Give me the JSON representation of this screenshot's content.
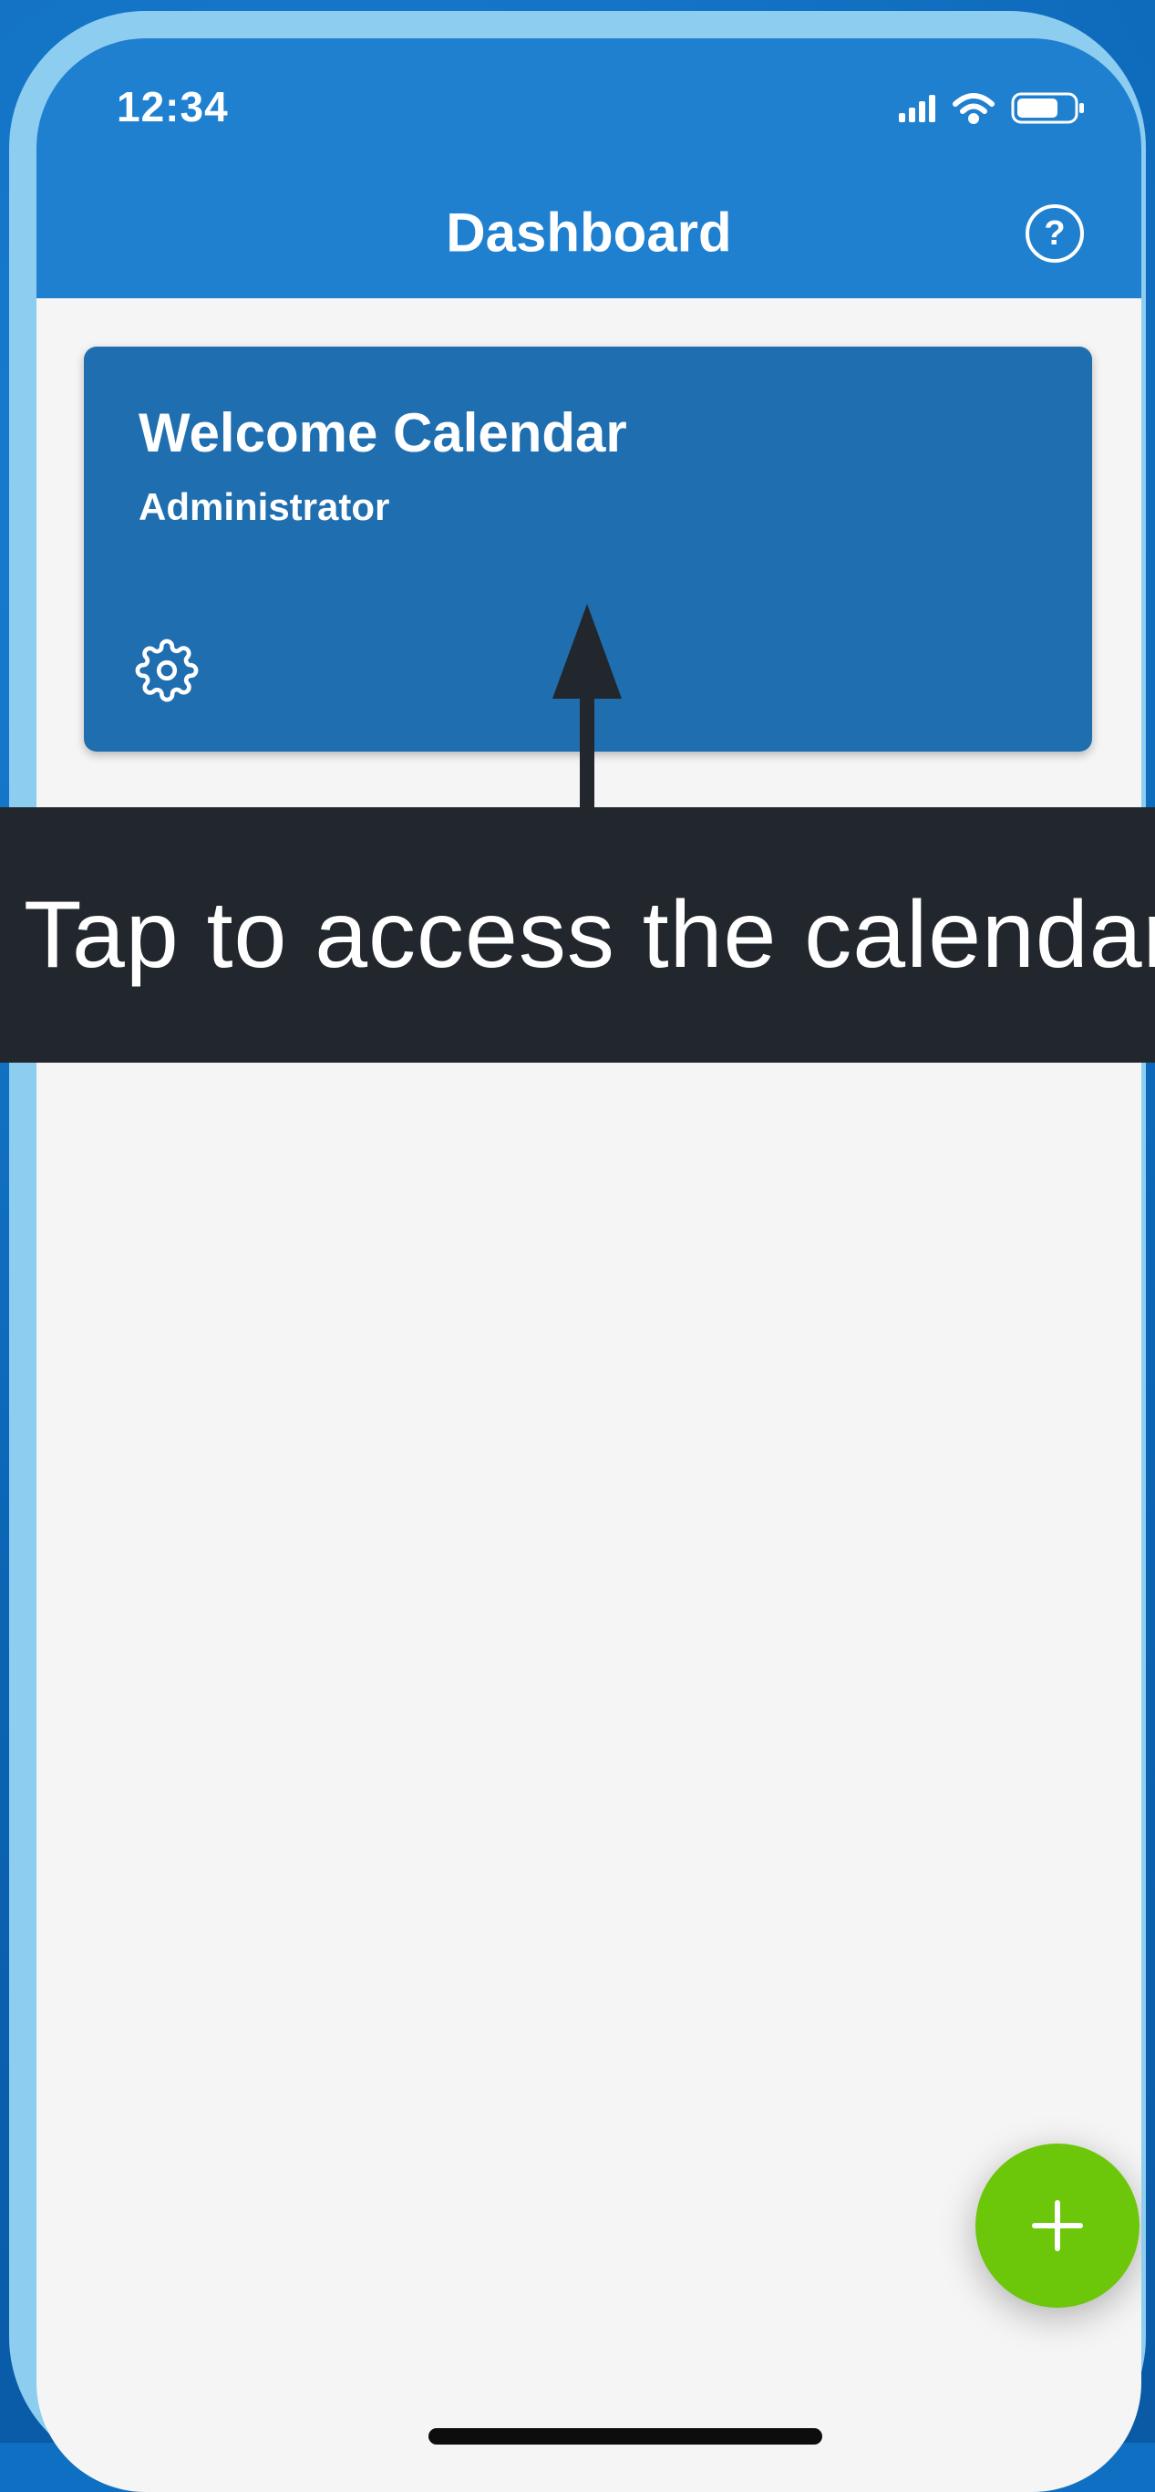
{
  "status_bar": {
    "time": "12:34",
    "icons": [
      "signal-icon",
      "wifi-icon",
      "battery-icon"
    ]
  },
  "header": {
    "title": "Dashboard",
    "help_icon": "question-icon",
    "help_glyph": "?"
  },
  "calendar_card": {
    "title": "Welcome Calendar",
    "subtitle": "Administrator",
    "settings_icon": "gear-icon"
  },
  "callout": {
    "text": "Tap to access the calendar",
    "arrow_icon": "arrow-up-icon"
  },
  "fab": {
    "icon": "plus-icon"
  },
  "colors": {
    "header": "#1f80d0",
    "card": "#1f6eb0",
    "callout": "#22272d",
    "fab": "#6cc60a",
    "screen": "#f5f5f5",
    "rim": "#8dcdf0"
  }
}
